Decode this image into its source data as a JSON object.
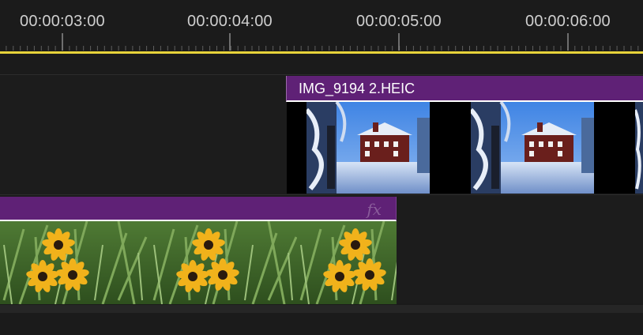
{
  "timeline": {
    "ruler": {
      "timecodes": [
        "00:00:03:00",
        "00:00:04:00",
        "00:00:05:00",
        "00:00:06:00"
      ]
    },
    "colors": {
      "playhead_line": "#e7d33a",
      "clip_header": "#5f2176",
      "background": "#1b1b1b"
    },
    "clips": {
      "upper": {
        "name": "IMG_9194 2.HEIC",
        "thumbnail": "snowy-house-thumbnail"
      },
      "lower": {
        "effect_badge": "fx",
        "thumbnail": "yellow-flowers-thumbnail"
      }
    }
  }
}
